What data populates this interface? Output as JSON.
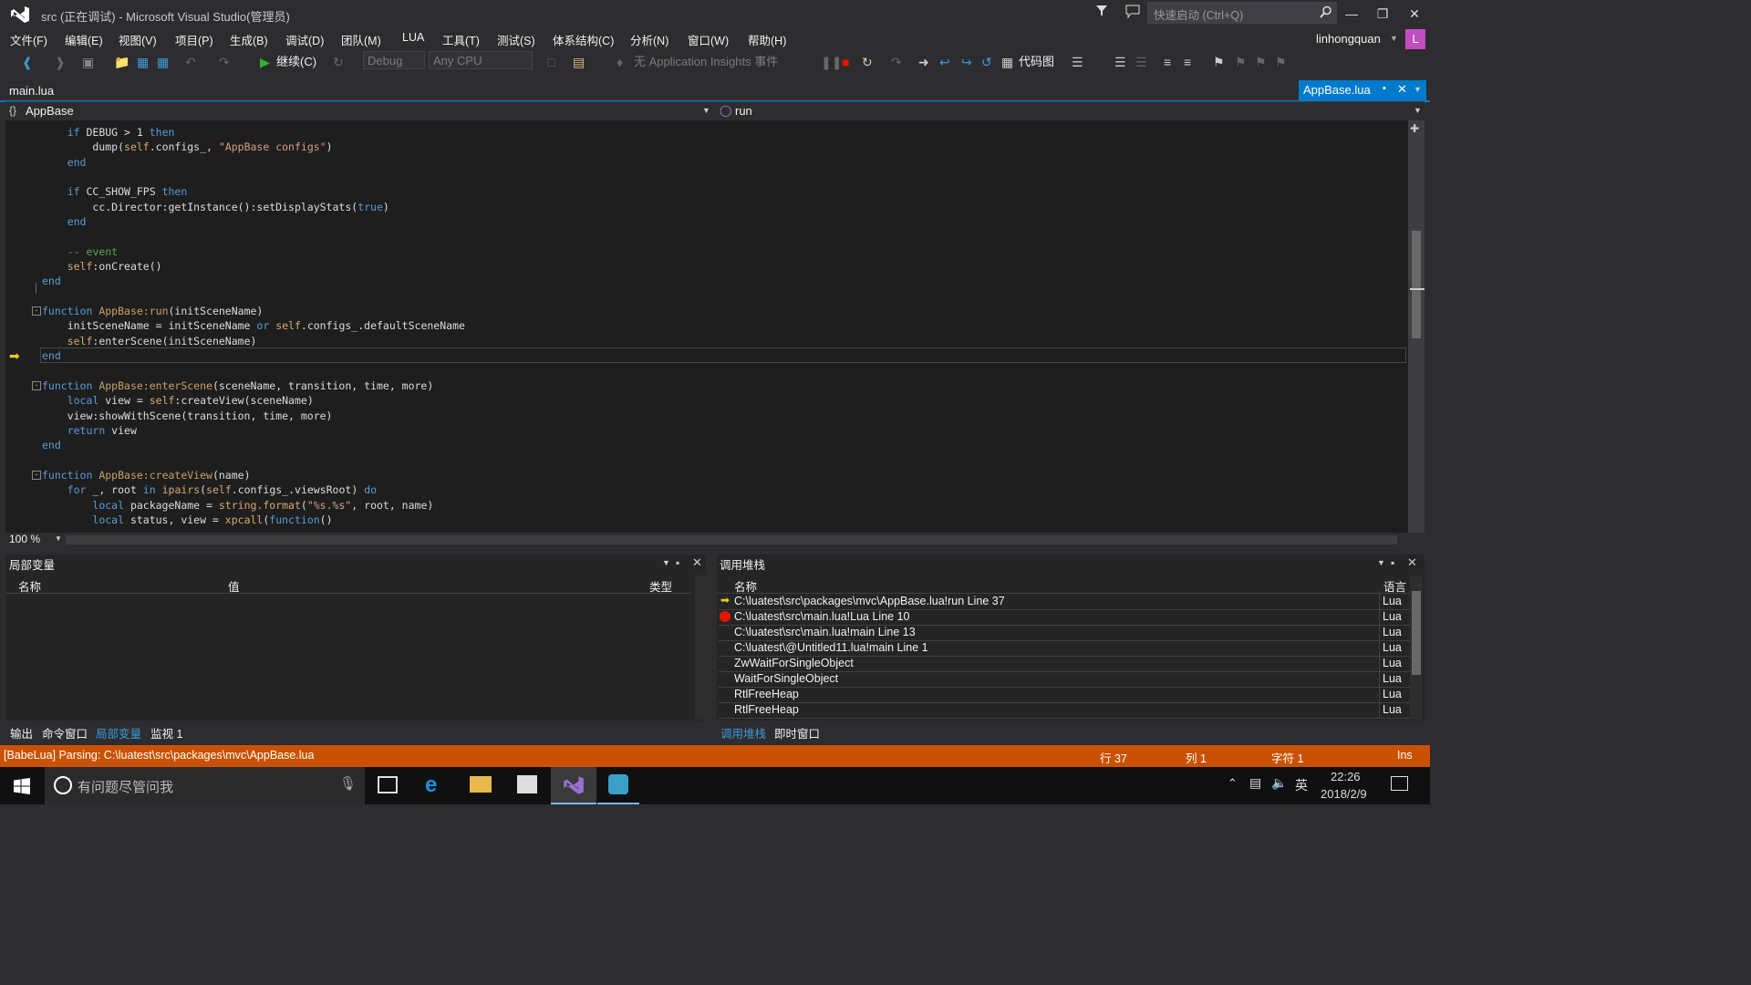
{
  "window": {
    "title": "src (正在调试) - Microsoft Visual Studio(管理员)",
    "quick_launch_placeholder": "快速启动 (Ctrl+Q)",
    "user": "linhongquan",
    "avatar_letter": "L"
  },
  "menu": [
    "文件(F)",
    "编辑(E)",
    "视图(V)",
    "项目(P)",
    "生成(B)",
    "调试(D)",
    "团队(M)",
    "LUA",
    "工具(T)",
    "测试(S)",
    "体系结构(C)",
    "分析(N)",
    "窗口(W)",
    "帮助(H)"
  ],
  "toolbar": {
    "continue_label": "继续(C)",
    "config": "Debug",
    "platform": "Any CPU",
    "insights": "无 Application Insights 事件",
    "codemap_label": "代码图"
  },
  "tabs": {
    "left_file": "main.lua",
    "active_file": "AppBase.lua"
  },
  "navbar": {
    "scope": "AppBase",
    "member": "run"
  },
  "editor": {
    "zoom": "100 %"
  },
  "locals_panel": {
    "title": "局部变量",
    "col_name": "名称",
    "col_value": "值",
    "col_type": "类型"
  },
  "callstack_panel": {
    "title": "调用堆栈",
    "col_name": "名称",
    "col_lang": "语言",
    "rows": [
      {
        "name": "C:\\luatest\\src\\packages\\mvc\\AppBase.lua!run Line 37",
        "lang": "Lua",
        "marker": "arrow"
      },
      {
        "name": "C:\\luatest\\src\\main.lua!Lua Line 10",
        "lang": "Lua",
        "marker": "breakpoint"
      },
      {
        "name": "C:\\luatest\\src\\main.lua!main Line 13",
        "lang": "Lua",
        "marker": ""
      },
      {
        "name": "C:\\luatest\\@Untitled11.lua!main Line 1",
        "lang": "Lua",
        "marker": ""
      },
      {
        "name": "ZwWaitForSingleObject",
        "lang": "Lua",
        "marker": ""
      },
      {
        "name": "WaitForSingleObject",
        "lang": "Lua",
        "marker": ""
      },
      {
        "name": "RtlFreeHeap",
        "lang": "Lua",
        "marker": ""
      },
      {
        "name": "RtlFreeHeap",
        "lang": "Lua",
        "marker": ""
      }
    ]
  },
  "bottom_tabs_left": [
    "输出",
    "命令窗口",
    "局部变量",
    "监视 1"
  ],
  "bottom_tabs_right": [
    "调用堆栈",
    "即时窗口"
  ],
  "status": {
    "message": "[BabeLua] Parsing: C:\\luatest\\src\\packages\\mvc\\AppBase.lua",
    "line": "行 37",
    "col": "列 1",
    "char": "字符 1",
    "mode": "Ins"
  },
  "taskbar": {
    "search_placeholder": "有问题尽管问我",
    "ime": "英",
    "time": "22:26",
    "date": "2018/2/9"
  },
  "colors": {
    "accent": "#007acc",
    "status": "#ca5100",
    "avatar": "#c04ec0"
  }
}
